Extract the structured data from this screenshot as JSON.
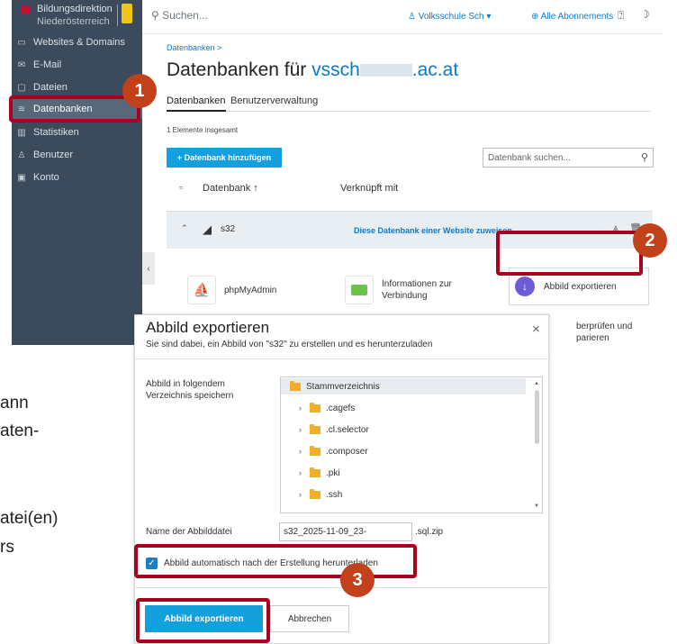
{
  "sidebar": {
    "brand_line1": "Bildungsdirektion",
    "brand_line2": "Niederösterreich",
    "items": [
      {
        "label": "Websites & Domains",
        "icon": "monitor-icon"
      },
      {
        "label": "E-Mail",
        "icon": "mail-icon"
      },
      {
        "label": "Dateien",
        "icon": "folder-icon"
      },
      {
        "label": "Datenbanken",
        "icon": "database-icon",
        "active": true
      },
      {
        "label": "Statistiken",
        "icon": "bar-chart-icon"
      },
      {
        "label": "Benutzer",
        "icon": "user-icon"
      },
      {
        "label": "Konto",
        "icon": "id-card-icon"
      }
    ]
  },
  "topbar": {
    "search_placeholder": "Suchen...",
    "user": "Volksschule Sch",
    "subscriptions": "Alle Abonnements"
  },
  "main": {
    "breadcrumb": "Datenbanken >",
    "title_prefix": "Datenbanken für ",
    "title_domain_start": "vssch",
    "title_domain_end": ".ac.at",
    "tabs": [
      "Datenbanken",
      "Benutzerverwaltung"
    ],
    "count_text": "1 Elemente insgesamt",
    "add_button": "+ Datenbank hinzufügen",
    "db_search_placeholder": "Datenbank suchen...",
    "columns": {
      "database": "Datenbank ↑",
      "linked": "Verknüpft mit"
    },
    "db_row": {
      "name": "s32",
      "assign_link": "Diese Datenbank einer Website zuweisen"
    },
    "tools": {
      "phpmyadmin": "phpMyAdmin",
      "info_line1": "Informationen zur",
      "info_line2": "Verbindung",
      "export": "Abbild exportieren",
      "check_line1": "berprüfen und",
      "check_line2": "parieren"
    }
  },
  "dialog": {
    "title": "Abbild exportieren",
    "subtitle": "Sie sind dabei, ein Abbild von \"s32\" zu erstellen und es herunterzuladen",
    "dir_label_line1": "Abbild in folgendem",
    "dir_label_line2": "Verzeichnis speichern",
    "tree": [
      "Stammverzeichnis",
      ".cagefs",
      ".cl.selector",
      ".composer",
      ".pki",
      ".ssh"
    ],
    "filename_label": "Name der Abbilddatei",
    "filename_value": "s32_2025-11-09_23-",
    "filename_ext": ".sql.zip",
    "auto_download": "Abbild automatisch nach der Erstellung herunterladen",
    "export_button": "Abbild exportieren",
    "cancel_button": "Abbrechen"
  },
  "annotations": {
    "badge1": "1",
    "badge2": "2",
    "badge3": "3",
    "color": "#a8001e"
  },
  "background_text": [
    "ann",
    "aten-",
    "atei(en)",
    "rs"
  ]
}
